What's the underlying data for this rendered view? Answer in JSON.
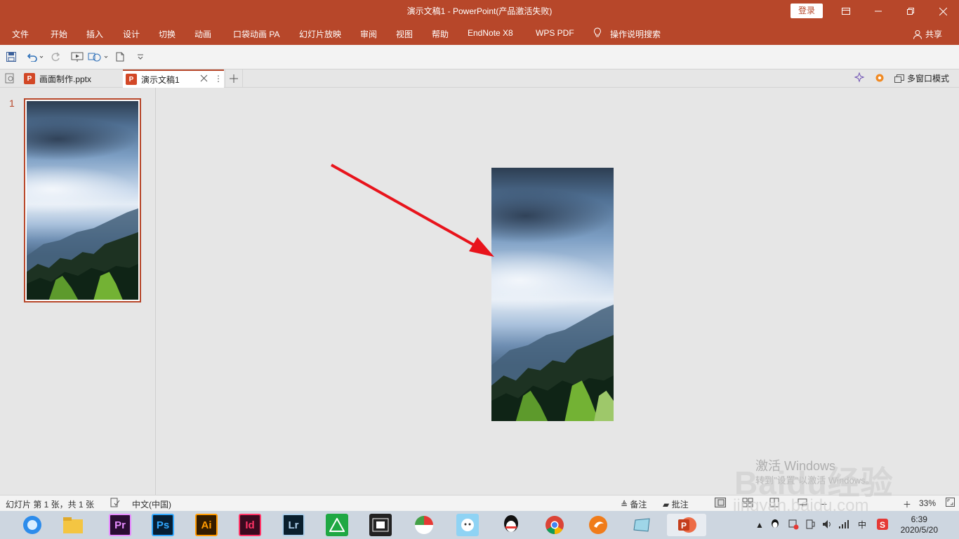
{
  "titlebar": {
    "title": "演示文稿1  -  PowerPoint(产品激活失败)",
    "login": "登录"
  },
  "menu": {
    "items": [
      "文件",
      "开始",
      "插入",
      "设计",
      "切换",
      "动画",
      "口袋动画 PA",
      "幻灯片放映",
      "审阅",
      "视图",
      "帮助",
      "EndNote X8",
      "WPS PDF",
      "操作说明搜索"
    ],
    "share": "共享"
  },
  "tabs": {
    "items": [
      {
        "label": "画面制作.pptx"
      },
      {
        "label": "演示文稿1"
      }
    ],
    "multiwindow": "多窗口模式"
  },
  "thumbnails": {
    "slide_number": "1"
  },
  "statusbar": {
    "slide_info": "幻灯片 第 1 张，共 1 张",
    "language": "中文(中国)",
    "notes": "备注",
    "comments": "批注",
    "zoom": "33%"
  },
  "taskbar": {
    "apps": [
      "Pr",
      "Ps",
      "Ai",
      "Id",
      "Lr"
    ],
    "ime": "中",
    "time": "6:39",
    "date": "2020/5/20"
  },
  "watermark": {
    "activate": "激活 Windows",
    "baidu": "Baidu经验",
    "url": "jingyan.baidu.com"
  },
  "colors": {
    "accent": "#b7472a",
    "arrow": "#e8141c"
  }
}
